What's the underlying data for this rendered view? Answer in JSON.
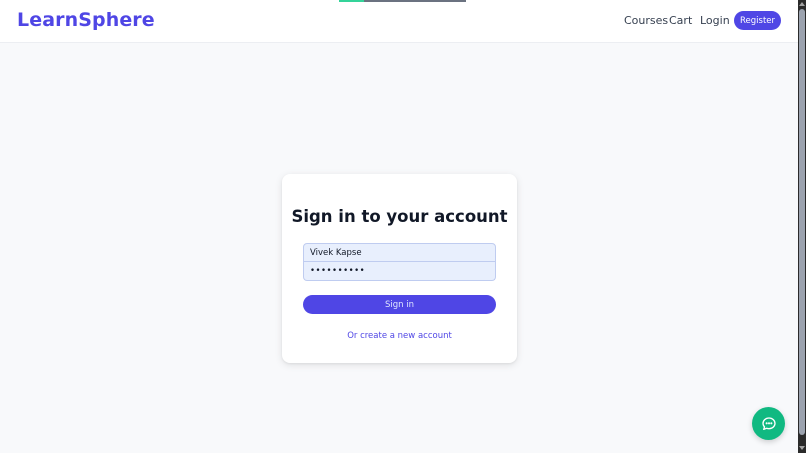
{
  "header": {
    "brand": "LearnSphere",
    "nav": {
      "courses": "Courses",
      "cart": "Cart",
      "login": "Login",
      "register": "Register"
    },
    "loading_progress": 0.2
  },
  "login_card": {
    "title": "Sign in to your account",
    "username_value": "Vivek Kapse",
    "password_value": "••••••••••",
    "signin_label": "Sign in",
    "create_account_link": "Or create a new account"
  },
  "floating": {
    "chat_icon": "chat-bubble-icon"
  },
  "colors": {
    "brand": "#4f46e5",
    "chat": "#10b981",
    "input_bg": "#e8effd"
  }
}
